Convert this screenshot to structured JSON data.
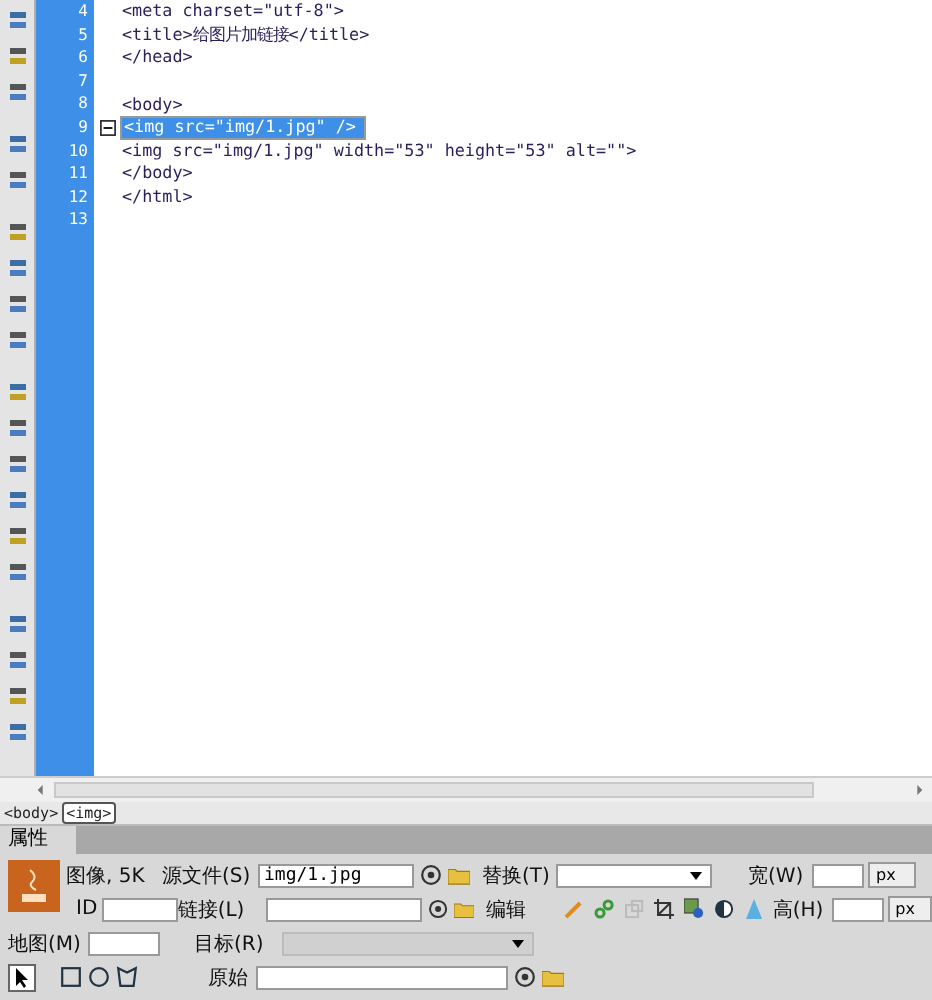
{
  "code_lines": [
    {
      "number": "4",
      "text": "<meta charset=\"utf-8\">",
      "selected": false,
      "fold": false
    },
    {
      "number": "5",
      "text": "<title>给图片加链接</title>",
      "selected": false,
      "fold": false
    },
    {
      "number": "6",
      "text": "</head>",
      "selected": false,
      "fold": false
    },
    {
      "number": "7",
      "selected": false,
      "fold": false
    },
    {
      "number": "8",
      "text": "<body>",
      "selected": false,
      "fold": false
    },
    {
      "number": "9",
      "text": "<img src=\"img/1.jpg\" />",
      "selected": true,
      "fold": true
    },
    {
      "number": "10",
      "text": "<img src=\"img/1.jpg\" width=\"53\" height=\"53\" alt=\"\">",
      "selected": false,
      "fold": false
    },
    {
      "number": "11",
      "text": "</body>",
      "selected": false,
      "fold": false
    },
    {
      "number": "12",
      "text": "</html>",
      "selected": false,
      "fold": false
    },
    {
      "number": "13",
      "selected": false,
      "fold": false
    }
  ],
  "tag_selector": [
    {
      "text": "<body>",
      "selected": false
    },
    {
      "text": "<img>",
      "selected": true
    }
  ],
  "properties": {
    "tab": "属性",
    "image_info": "图像, 5K",
    "src": {
      "label": "源文件(S)",
      "value": "img/1.jpg"
    },
    "alt": {
      "label": "替换(T)"
    },
    "width": {
      "label": "宽(W)",
      "unit": "px"
    },
    "id": {
      "label": "ID"
    },
    "link": {
      "label": "链接(L)"
    },
    "edit": {
      "label": "编辑"
    },
    "height": {
      "label": "高(H)",
      "unit": "px"
    },
    "map": {
      "label": "地图(M)"
    },
    "target": {
      "label": "目标(R)",
      "disabled": true
    },
    "original": {
      "label": "原始"
    }
  }
}
